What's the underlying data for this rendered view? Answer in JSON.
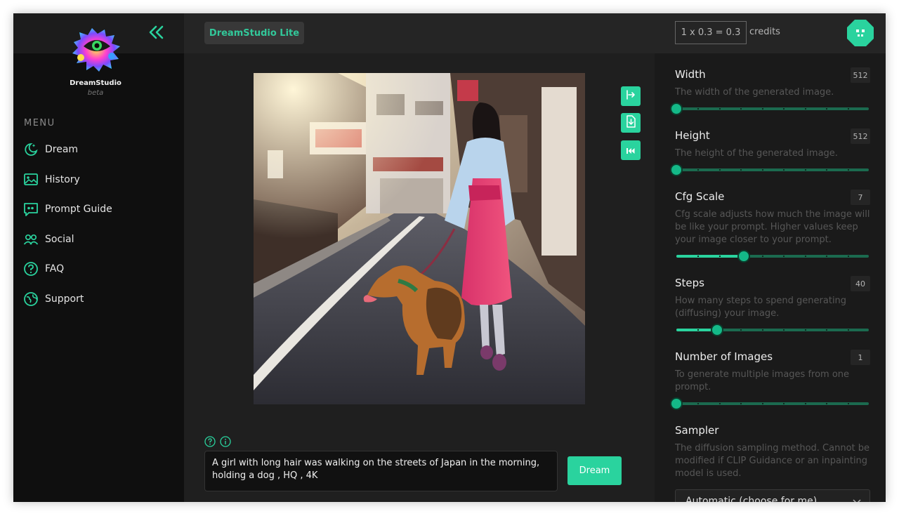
{
  "brand": {
    "name": "DreamStudio",
    "tag": "beta"
  },
  "menu": {
    "title": "MENU",
    "items": [
      {
        "label": "Dream",
        "icon": "moon-stars-icon"
      },
      {
        "label": "History",
        "icon": "image-icon"
      },
      {
        "label": "Prompt Guide",
        "icon": "quote-icon"
      },
      {
        "label": "Social",
        "icon": "users-icon"
      },
      {
        "label": "FAQ",
        "icon": "question-icon"
      },
      {
        "label": "Support",
        "icon": "globe-icon"
      }
    ]
  },
  "header": {
    "app_name": "DreamStudio Lite"
  },
  "credits": {
    "formula": "1 x 0.3 = 0.3",
    "label": "credits"
  },
  "prompt": {
    "text": "A girl with long hair was walking on the streets of Japan in the morning, holding a dog , HQ , 4K"
  },
  "dream_button": "Dream",
  "params": [
    {
      "label": "Width",
      "value": "512",
      "desc": "The width of the generated image.",
      "level": 0.0
    },
    {
      "label": "Height",
      "value": "512",
      "desc": "The height of the generated image.",
      "level": 0.0
    },
    {
      "label": "Cfg Scale",
      "value": "7",
      "desc": "Cfg scale adjusts how much the image will be like your prompt. Higher values keep your image closer to your prompt.",
      "level": 0.35
    },
    {
      "label": "Steps",
      "value": "40",
      "desc": "How many steps to spend generating (diffusing) your image.",
      "level": 0.21
    },
    {
      "label": "Number of Images",
      "value": "1",
      "desc": "To generate multiple images from one prompt.",
      "level": 0.0
    }
  ],
  "sampler": {
    "label": "Sampler",
    "desc": "The diffusion sampling method. Cannot be modified if CLIP Guidance or an inpainting model is used.",
    "selected": "Automatic (choose for me)"
  },
  "colors": {
    "accent": "#2ad39e",
    "track": "#1b6a4f",
    "sidebar": "#0f0f0f",
    "panel": "#1a1a1a"
  }
}
